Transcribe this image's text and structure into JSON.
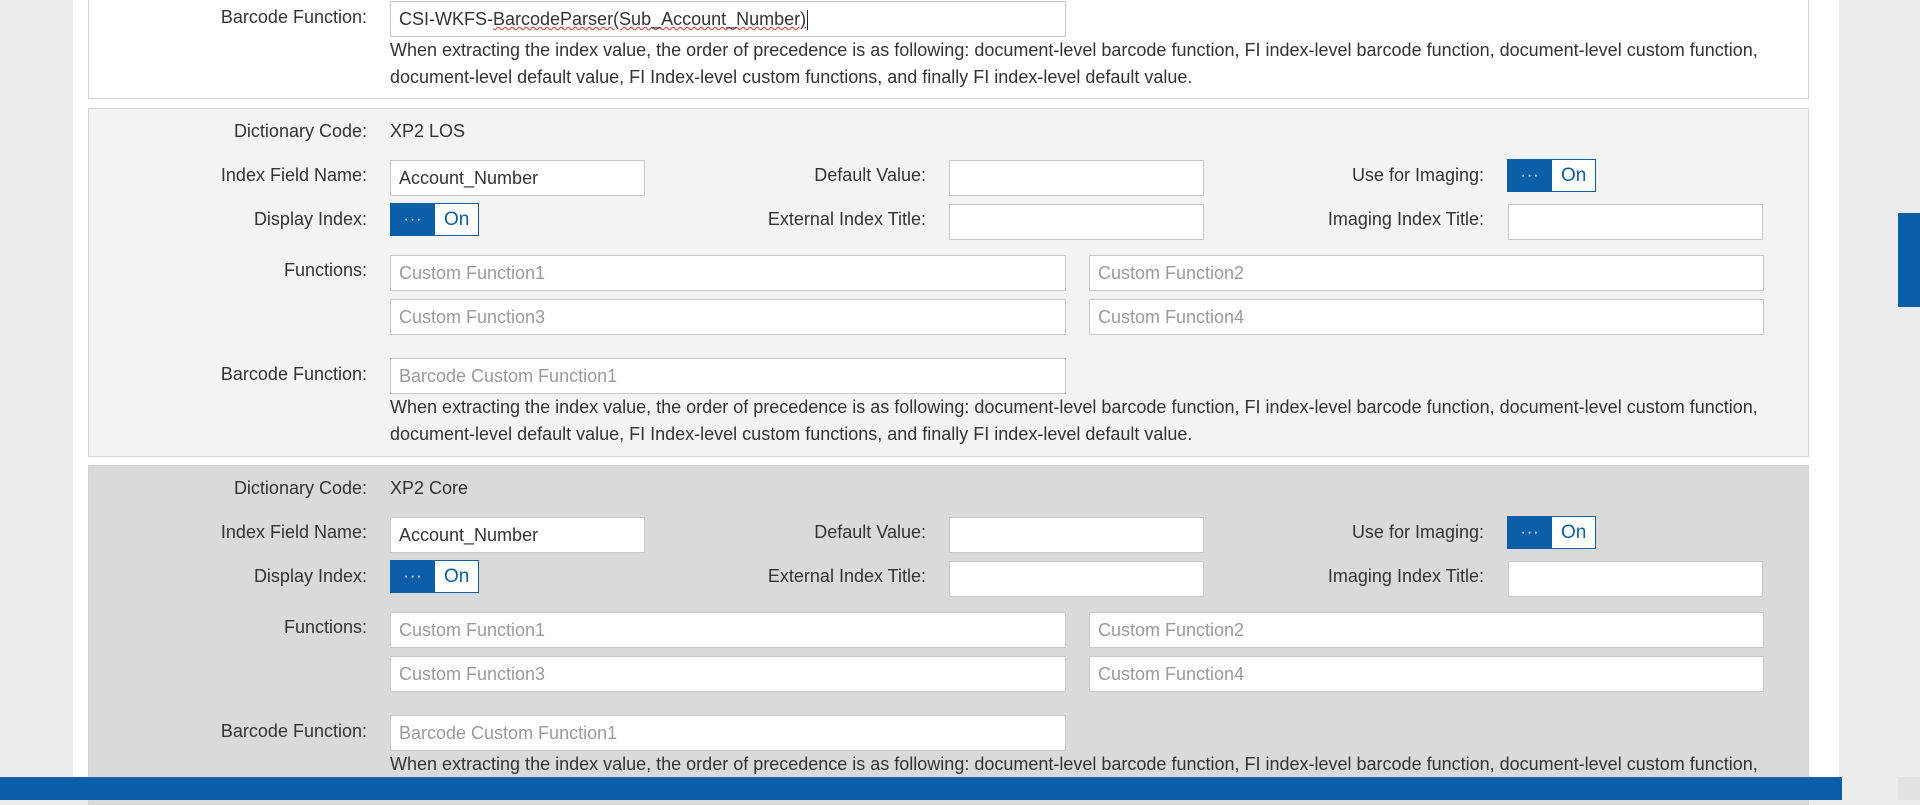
{
  "top_section": {
    "barcode_label": "Barcode Function:",
    "barcode_value_prefix": "CSI-WKFS-",
    "barcode_value_underlined": "BarcodeParser(Sub_Account_Number)",
    "note_line1": "When extracting the index value, the order of precedence is as following: document-level barcode function, FI index-level barcode function, document-level custom function,",
    "note_line2": "document-level default value, FI Index-level custom functions, and finally FI index-level default value."
  },
  "sections": [
    {
      "dictionary_code_label": "Dictionary Code:",
      "dictionary_code": "XP2 LOS",
      "index_field_name_label": "Index Field Name:",
      "index_field_name": "Account_Number",
      "default_value_label": "Default Value:",
      "default_value": "",
      "use_for_imaging_label": "Use for Imaging:",
      "use_for_imaging_state": "On",
      "display_index_label": "Display Index:",
      "display_index_state": "On",
      "external_index_title_label": "External Index Title:",
      "external_index_title": "",
      "imaging_index_title_label": "Imaging Index Title:",
      "imaging_index_title": "",
      "functions_label": "Functions:",
      "custom_function1_placeholder": "Custom Function1",
      "custom_function2_placeholder": "Custom Function2",
      "custom_function3_placeholder": "Custom Function3",
      "custom_function4_placeholder": "Custom Function4",
      "barcode_label": "Barcode Function:",
      "barcode_placeholder": "Barcode Custom Function1",
      "note_line1": "When extracting the index value, the order of precedence is as following: document-level barcode function, FI index-level barcode function, document-level custom function,",
      "note_line2": "document-level default value, FI Index-level custom functions, and finally FI index-level default value."
    },
    {
      "dictionary_code_label": "Dictionary Code:",
      "dictionary_code": "XP2 Core",
      "index_field_name_label": "Index Field Name:",
      "index_field_name": "Account_Number",
      "default_value_label": "Default Value:",
      "default_value": "",
      "use_for_imaging_label": "Use for Imaging:",
      "use_for_imaging_state": "On",
      "display_index_label": "Display Index:",
      "display_index_state": "On",
      "external_index_title_label": "External Index Title:",
      "external_index_title": "",
      "imaging_index_title_label": "Imaging Index Title:",
      "imaging_index_title": "",
      "functions_label": "Functions:",
      "custom_function1_placeholder": "Custom Function1",
      "custom_function2_placeholder": "Custom Function2",
      "custom_function3_placeholder": "Custom Function3",
      "custom_function4_placeholder": "Custom Function4",
      "barcode_label": "Barcode Function:",
      "barcode_placeholder": "Barcode Custom Function1",
      "note_line1": "When extracting the index value, the order of precedence is as following: document-level barcode function, FI index-level barcode function, document-level custom function,"
    }
  ],
  "toggle_knob_glyph": "···",
  "colors": {
    "accent": "#0b5ea8",
    "panel_light": "#f3f3f3",
    "panel_dark": "#dadada"
  }
}
